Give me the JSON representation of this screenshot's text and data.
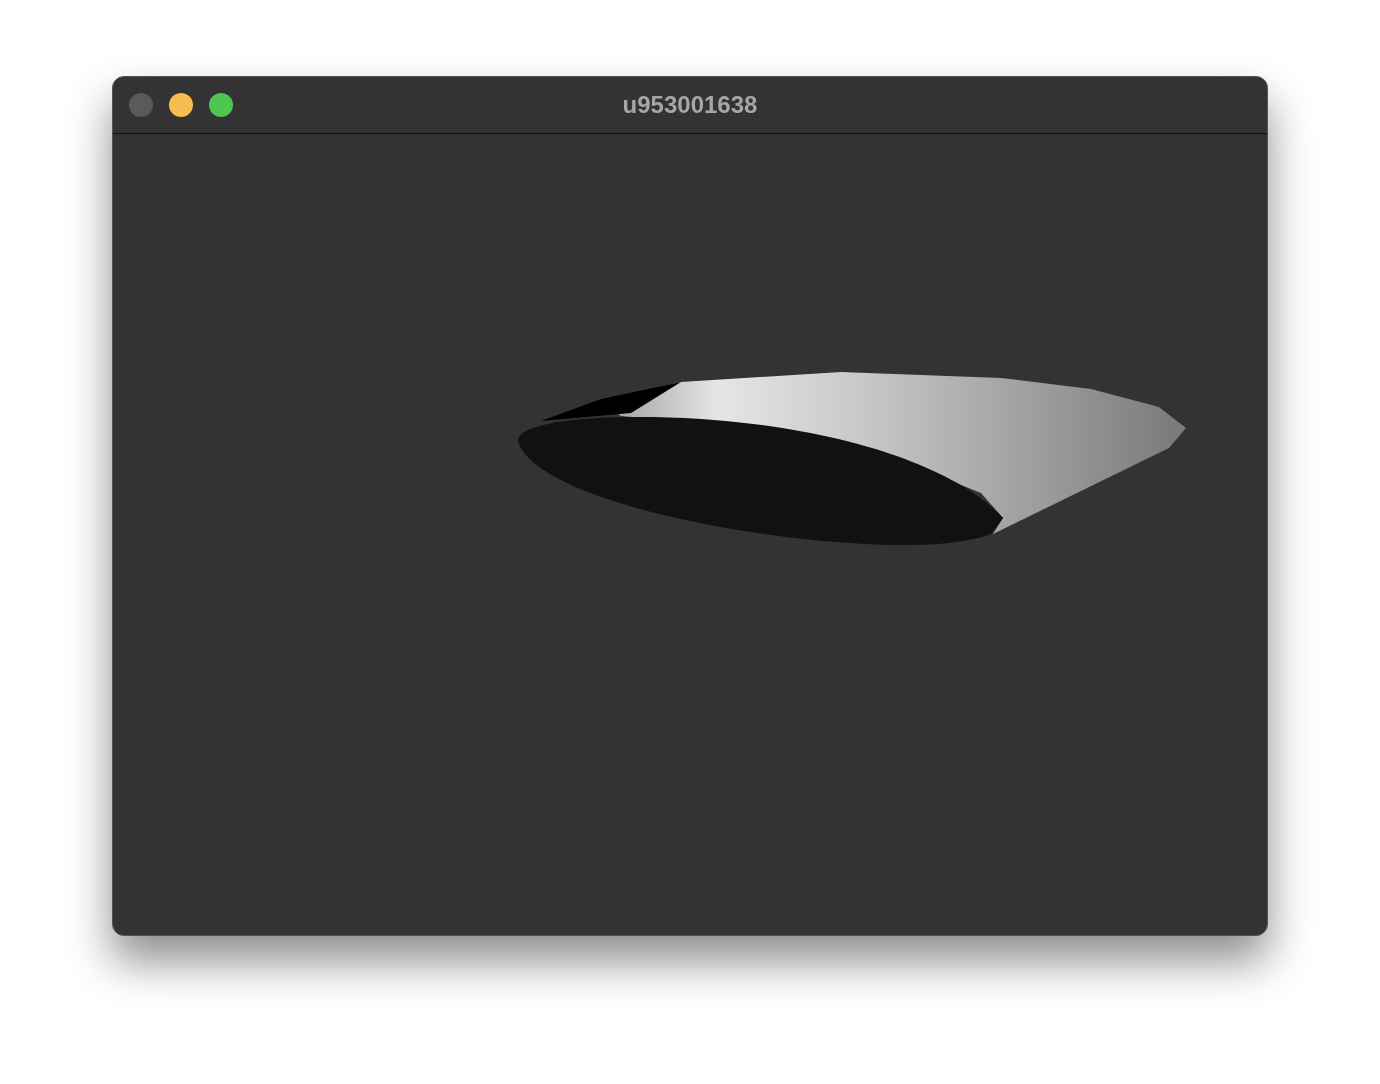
{
  "window": {
    "title": "u953001638",
    "buttons": [
      {
        "kind": "close",
        "disabled": true
      },
      {
        "kind": "minimize",
        "disabled": false
      },
      {
        "kind": "zoom",
        "disabled": false
      }
    ]
  }
}
